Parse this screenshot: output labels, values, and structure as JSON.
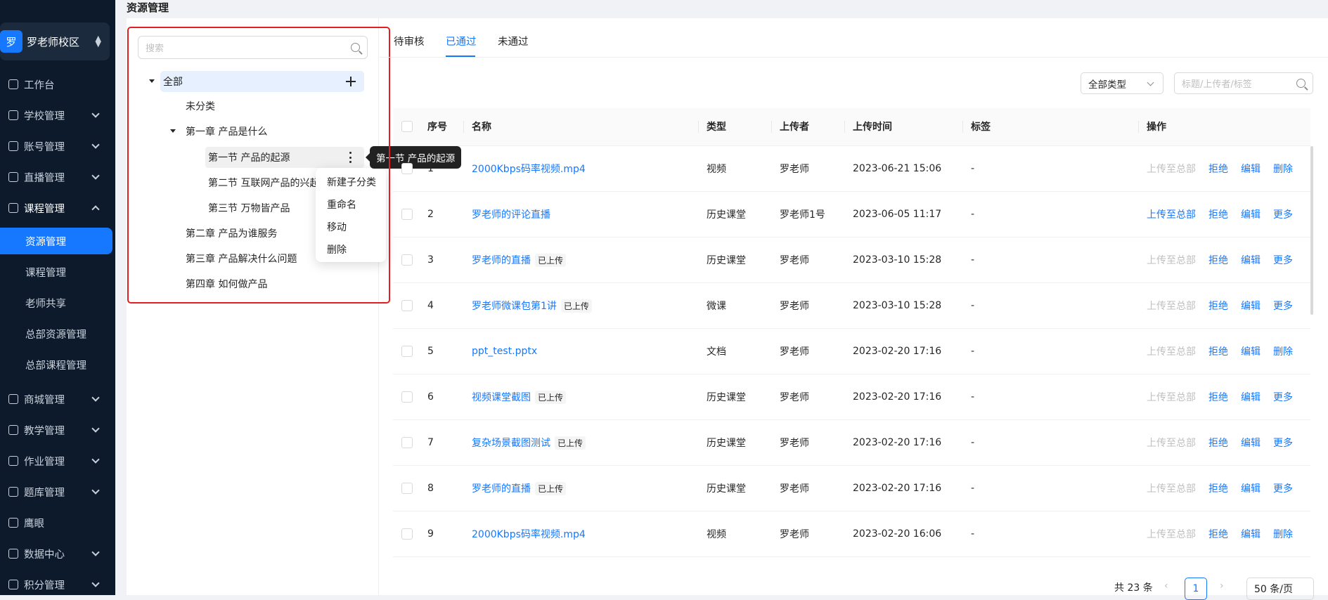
{
  "sidebar": {
    "school": {
      "avatar": "罗",
      "name": "罗老师校区"
    },
    "items": [
      {
        "label": "工作台",
        "icon": "dashboard-icon"
      },
      {
        "label": "学校管理",
        "icon": "school-icon"
      },
      {
        "label": "账号管理",
        "icon": "users-icon"
      },
      {
        "label": "直播管理",
        "icon": "live-icon"
      },
      {
        "label": "课程管理",
        "icon": "book-icon"
      },
      {
        "label": "商城管理",
        "icon": "shop-icon"
      },
      {
        "label": "教学管理",
        "icon": "teaching-icon"
      },
      {
        "label": "作业管理",
        "icon": "homework-icon"
      },
      {
        "label": "题库管理",
        "icon": "question-bank-icon"
      },
      {
        "label": "鹰眼",
        "icon": "eagle-eye-icon"
      },
      {
        "label": "数据中心",
        "icon": "data-icon"
      },
      {
        "label": "积分管理",
        "icon": "points-icon"
      }
    ],
    "sub_items": [
      "资源管理",
      "课程管理",
      "老师共享",
      "总部资源管理",
      "总部课程管理"
    ]
  },
  "page": {
    "title": "资源管理"
  },
  "tree": {
    "search_placeholder": "搜索",
    "nodes": [
      "全部",
      "未分类",
      "第一章 产品是什么",
      "第一节 产品的起源",
      "第二节 互联网产品的兴起",
      "第三节 万物皆产品",
      "第二章 产品为谁服务",
      "第三章 产品解决什么问题",
      "第四章 如何做产品"
    ],
    "tooltip": "第一节 产品的起源",
    "context_menu": [
      "新建子分类",
      "重命名",
      "移动",
      "删除"
    ]
  },
  "tabs": [
    "待审核",
    "已通过",
    "未通过"
  ],
  "filters": {
    "type_select": "全部类型",
    "search_placeholder": "标题/上传者/标签"
  },
  "table": {
    "headers": [
      "序号",
      "名称",
      "类型",
      "上传者",
      "上传时间",
      "标签",
      "操作"
    ],
    "rows": [
      {
        "no": "1",
        "name": "2000Kbps码率视频.mp4",
        "tag": "",
        "type": "视频",
        "uploader": "罗老师",
        "time": "2023-06-21 15:06",
        "label": "-",
        "ops": [
          "上传至总部",
          "拒绝",
          "编辑",
          "删除"
        ]
      },
      {
        "no": "2",
        "name": "罗老师的评论直播",
        "tag": "",
        "type": "历史课堂",
        "uploader": "罗老师1号",
        "time": "2023-06-05 11:17",
        "label": "-",
        "ops": [
          "上传至总部",
          "拒绝",
          "编辑",
          "更多"
        ]
      },
      {
        "no": "3",
        "name": "罗老师的直播",
        "tag": "已上传",
        "type": "历史课堂",
        "uploader": "罗老师",
        "time": "2023-03-10 15:28",
        "label": "-",
        "ops": [
          "上传至总部",
          "拒绝",
          "编辑",
          "更多"
        ]
      },
      {
        "no": "4",
        "name": "罗老师微课包第1讲",
        "tag": "已上传",
        "type": "微课",
        "uploader": "罗老师",
        "time": "2023-03-10 15:28",
        "label": "-",
        "ops": [
          "上传至总部",
          "拒绝",
          "编辑",
          "更多"
        ]
      },
      {
        "no": "5",
        "name": "ppt_test.pptx",
        "tag": "",
        "type": "文档",
        "uploader": "罗老师",
        "time": "2023-02-20 17:16",
        "label": "-",
        "ops": [
          "上传至总部",
          "拒绝",
          "编辑",
          "删除"
        ]
      },
      {
        "no": "6",
        "name": "视频课堂截图",
        "tag": "已上传",
        "type": "历史课堂",
        "uploader": "罗老师",
        "time": "2023-02-20 17:16",
        "label": "-",
        "ops": [
          "上传至总部",
          "拒绝",
          "编辑",
          "更多"
        ]
      },
      {
        "no": "7",
        "name": "复杂场景截图测试",
        "tag": "已上传",
        "type": "历史课堂",
        "uploader": "罗老师",
        "time": "2023-02-20 17:16",
        "label": "-",
        "ops": [
          "上传至总部",
          "拒绝",
          "编辑",
          "更多"
        ]
      },
      {
        "no": "8",
        "name": "罗老师的直播",
        "tag": "已上传",
        "type": "历史课堂",
        "uploader": "罗老师",
        "time": "2023-02-20 17:16",
        "label": "-",
        "ops": [
          "上传至总部",
          "拒绝",
          "编辑",
          "更多"
        ]
      },
      {
        "no": "9",
        "name": "2000Kbps码率视频.mp4",
        "tag": "",
        "type": "视频",
        "uploader": "罗老师",
        "time": "2023-02-20 16:06",
        "label": "-",
        "ops": [
          "上传至总部",
          "拒绝",
          "编辑",
          "删除"
        ]
      }
    ]
  },
  "pagination": {
    "total": "共 23 条",
    "current": "1",
    "page_size": "50 条/页"
  },
  "colors": {
    "accent": "#1677ff",
    "sidebar_bg": "#0c1a2b",
    "highlight_border": "#e02020"
  }
}
